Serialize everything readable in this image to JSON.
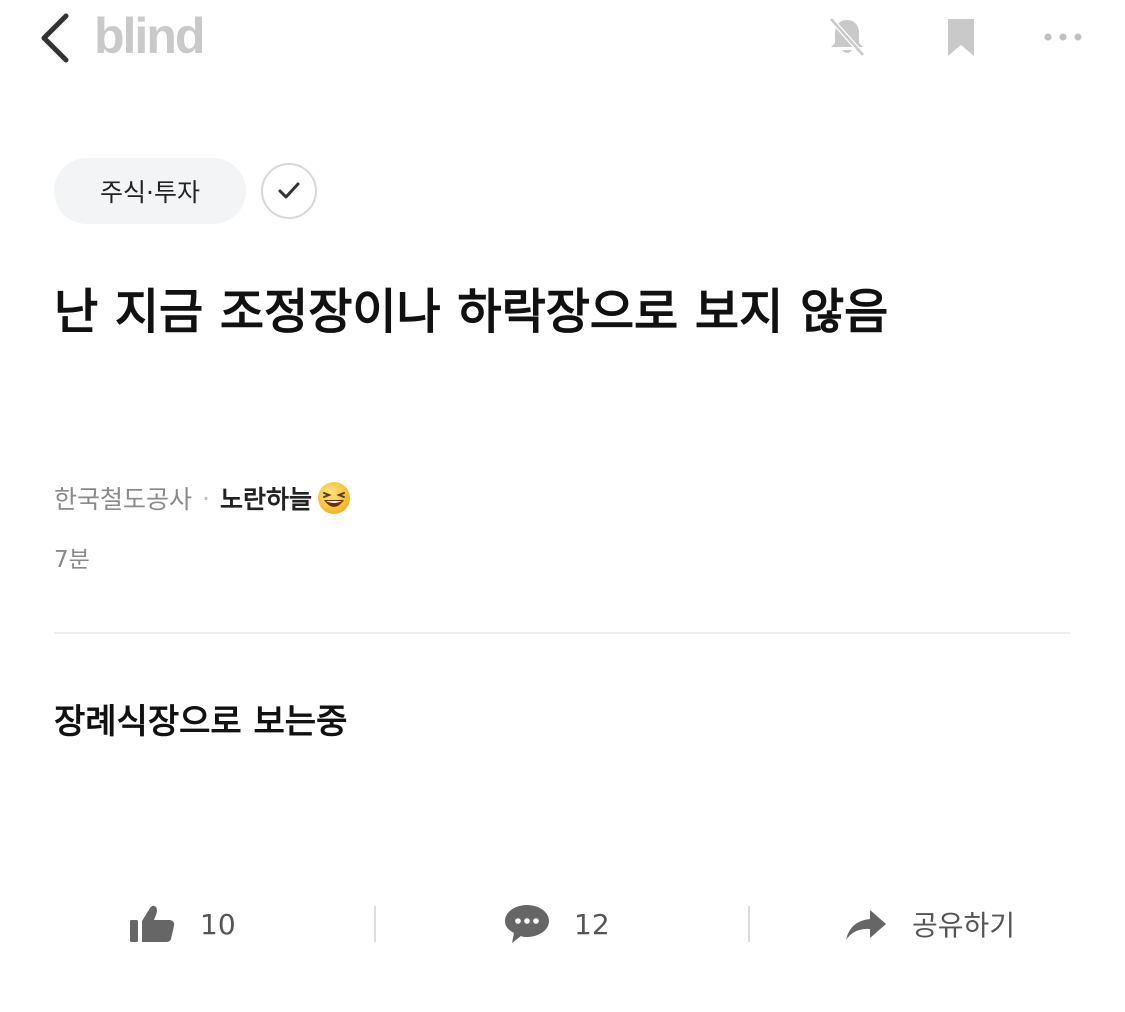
{
  "header": {
    "logo_text": "blind",
    "icons": [
      "back-chevron-icon",
      "notification-off-icon",
      "bookmark-icon",
      "more-icon"
    ]
  },
  "post": {
    "category": "주식·투자",
    "title": "난 지금 조정장이나 하락장으로 보지 않음",
    "company": "한국철도공사",
    "separator": "·",
    "author": "노란하늘",
    "time": "7분",
    "content": "장례식장으로 보는중"
  },
  "actions": {
    "likes": "10",
    "comments": "12",
    "share_label": "공유하기"
  },
  "colors": {
    "icon_gray": "#c9c9c9",
    "text_gray": "#8a8a8a",
    "chip_bg": "#f2f4f6"
  }
}
